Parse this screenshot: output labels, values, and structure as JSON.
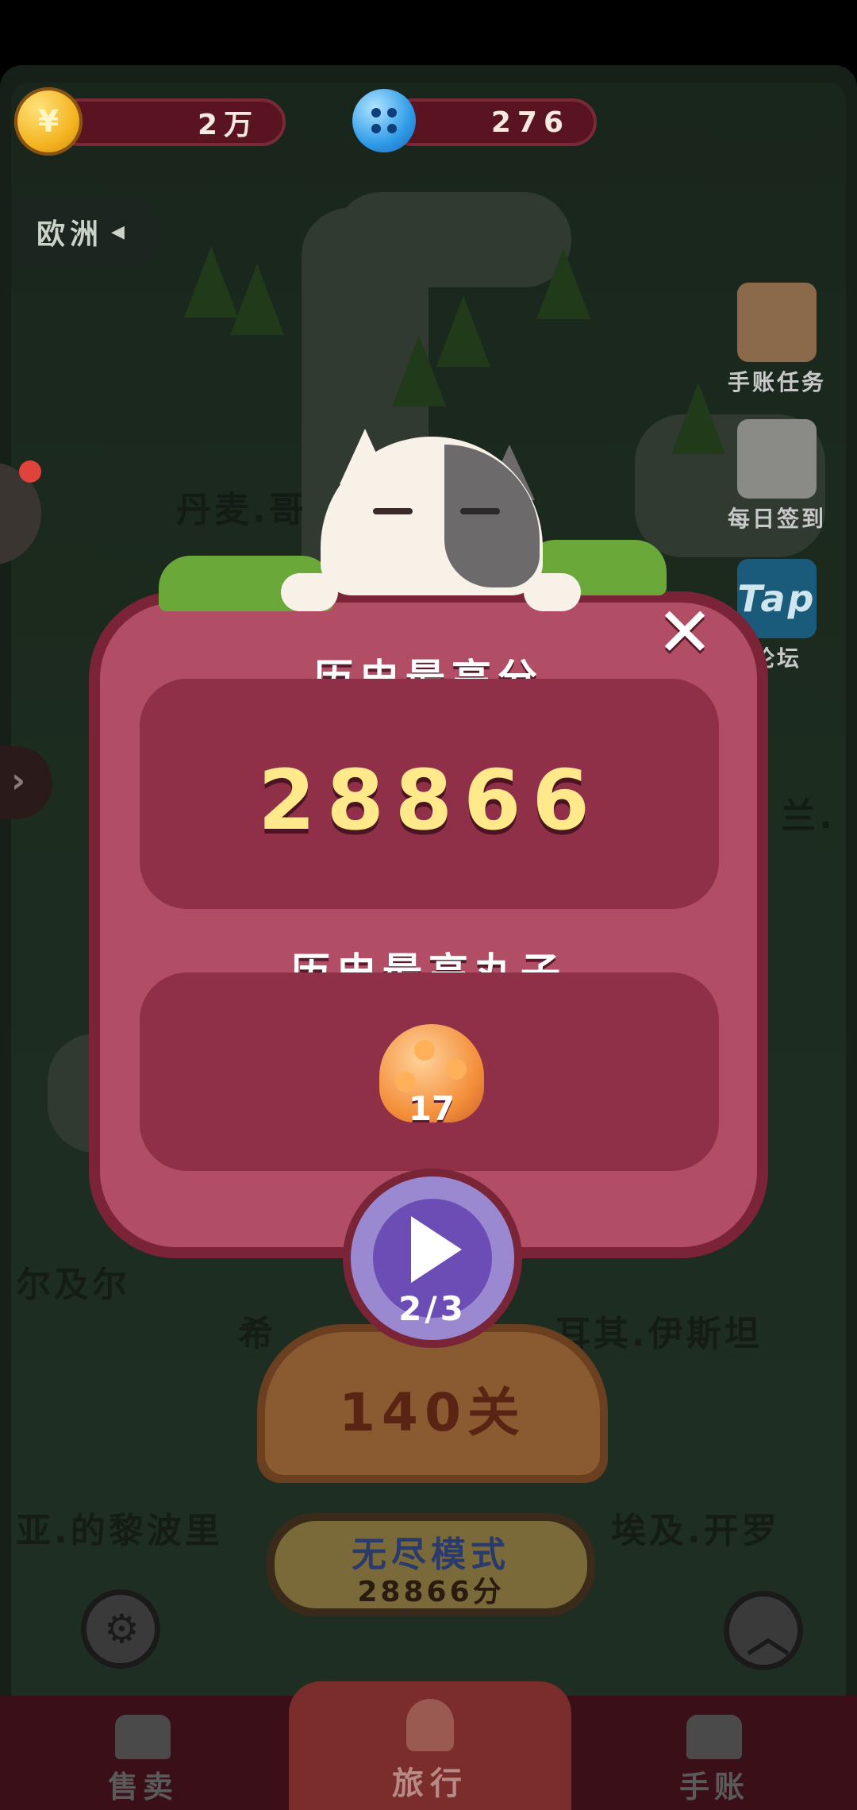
{
  "top_bar": {
    "coins": "2万",
    "coin_symbol": "¥",
    "buttons": "276"
  },
  "region_label": "欧洲",
  "side_menu": {
    "journal_tasks": "手账任务",
    "daily_checkin": "每日签到",
    "tap_forum": "论坛",
    "tap_logo": "Tap"
  },
  "map_labels": {
    "denmark": "丹麦.哥",
    "fragment_right": "兰.",
    "egypt_left": "尔及尔",
    "turkey": "耳其.伊斯坦",
    "libya": "亚.的黎波里",
    "cairo": "埃及.开罗",
    "greece": "希"
  },
  "dialog": {
    "high_score_title": "历史最高分",
    "high_score_value": "28866",
    "high_dumpling_title": "历史最高丸子",
    "dumpling_count": "17",
    "close": "✕",
    "play_count": "2/3"
  },
  "level_button": {
    "label": "140关"
  },
  "endless_button": {
    "label": "无尽模式",
    "score": "28866分"
  },
  "bottom_nav": {
    "sell": "售卖",
    "travel": "旅行",
    "journal": "手账"
  }
}
